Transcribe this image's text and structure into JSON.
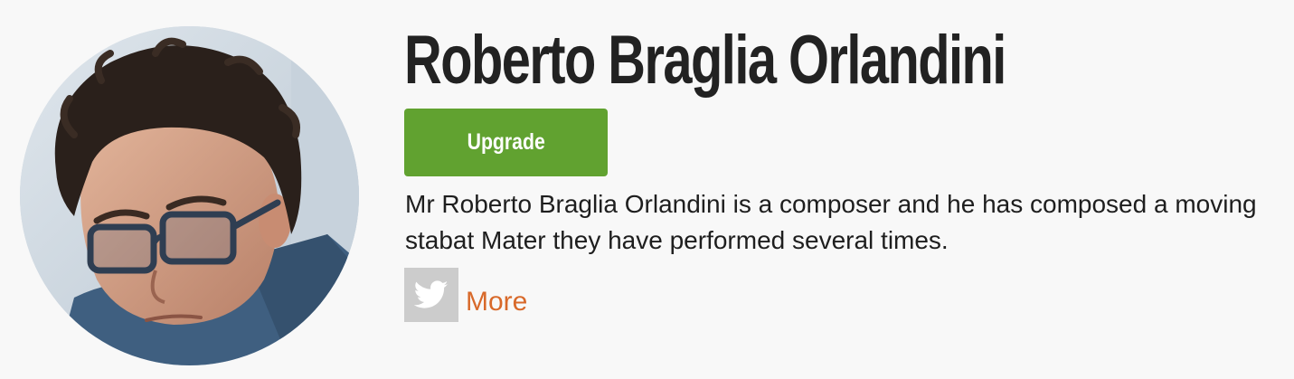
{
  "profile": {
    "name": "Roberto Braglia Orlandini",
    "upgrade_label": "Upgrade",
    "bio": "Mr Roberto Braglia Orlandini is a composer and he has composed a moving stabat Mater they have performed several times.",
    "more_label": "More",
    "social_icon": "twitter-icon",
    "accent_color": "#61a230",
    "link_color": "#d8692a"
  }
}
